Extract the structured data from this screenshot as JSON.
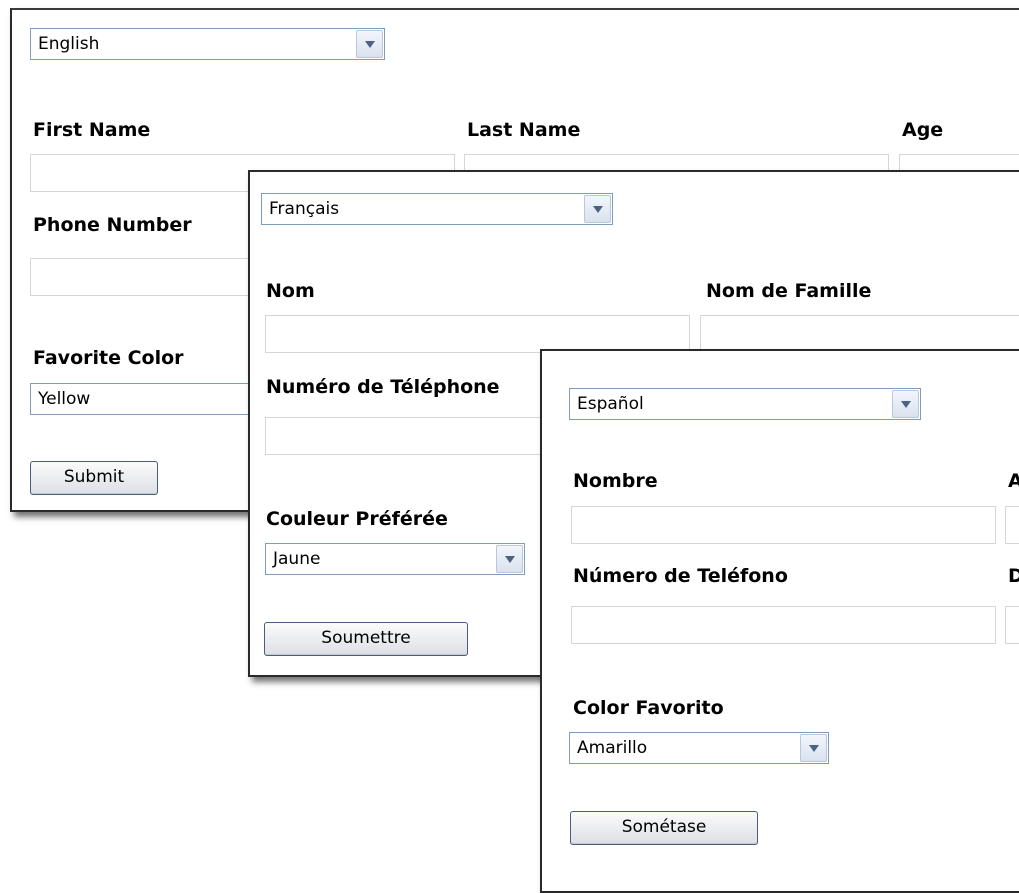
{
  "english": {
    "language": "English",
    "first_name_label": "First Name",
    "last_name_label": "Last Name",
    "age_label": "Age",
    "phone_label": "Phone Number",
    "color_label": "Favorite Color",
    "color_value": "Yellow",
    "submit_label": "Submit"
  },
  "french": {
    "language": "Français",
    "first_name_label": "Nom",
    "last_name_label": "Nom de Famille",
    "phone_label": "Numéro de Téléphone",
    "color_label": "Couleur Préférée",
    "color_value": "Jaune",
    "submit_label": "Soumettre"
  },
  "spanish": {
    "language": "Español",
    "first_name_label": "Nombre",
    "second_column_label_partial": "A",
    "phone_label": "Número de Teléfono",
    "fourth_label_partial": "D",
    "color_label": "Color Favorito",
    "color_value": "Amarillo",
    "submit_label": "Sométase"
  }
}
